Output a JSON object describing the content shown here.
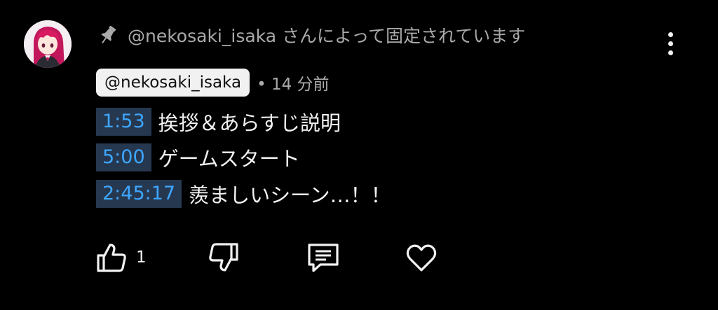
{
  "comment": {
    "pinned_text": "@nekosaki_isaka さんによって固定されています",
    "author": "@nekosaki_isaka",
    "time_meta": "• 14 分前",
    "lines": [
      {
        "timestamp": "1:53",
        "text": "挨拶＆あらすじ説明"
      },
      {
        "timestamp": "5:00",
        "text": "ゲームスタート"
      },
      {
        "timestamp": "2:45:17",
        "text": "羨ましいシーン…！！"
      }
    ]
  },
  "actions": {
    "like_count": "1"
  },
  "icons": {
    "pin": "pin-icon",
    "more": "more-vert-icon",
    "like": "thumb-up-icon",
    "dislike": "thumb-down-icon",
    "reply": "reply-comment-icon",
    "heart": "heart-icon"
  },
  "colors": {
    "background": "#000000",
    "timestamp_link": "#3ea6ff",
    "timestamp_bg": "#263850",
    "secondary_text": "#aaaaaa",
    "primary_text": "#f1f1f1"
  }
}
